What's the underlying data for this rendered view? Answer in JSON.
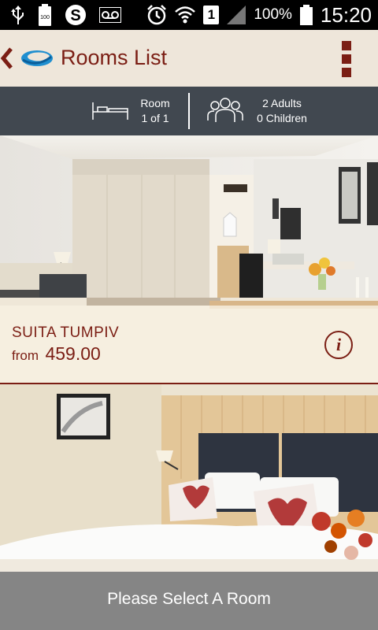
{
  "status_bar": {
    "battery_percent": "100%",
    "time": "15:20",
    "sim_slot": "1",
    "icons": [
      "usb-icon",
      "battery-saver-icon",
      "skype-icon",
      "voicemail-icon",
      "alarm-icon",
      "wifi-icon",
      "sim-icon",
      "signal-icon",
      "battery-icon"
    ]
  },
  "header": {
    "title": "Rooms List"
  },
  "info": {
    "room_label": "Room",
    "room_count": "1 of 1",
    "adults": "2 Adults",
    "children": "0 Children"
  },
  "rooms": [
    {
      "name": "SUITA TUMPIV",
      "from_label": "from",
      "price": "459.00"
    }
  ],
  "footer": {
    "select_label": "Please Select A Room"
  },
  "colors": {
    "accent": "#7b1e14",
    "info_bar": "#414850",
    "footer": "#858585",
    "header_bg": "#eee6da"
  }
}
